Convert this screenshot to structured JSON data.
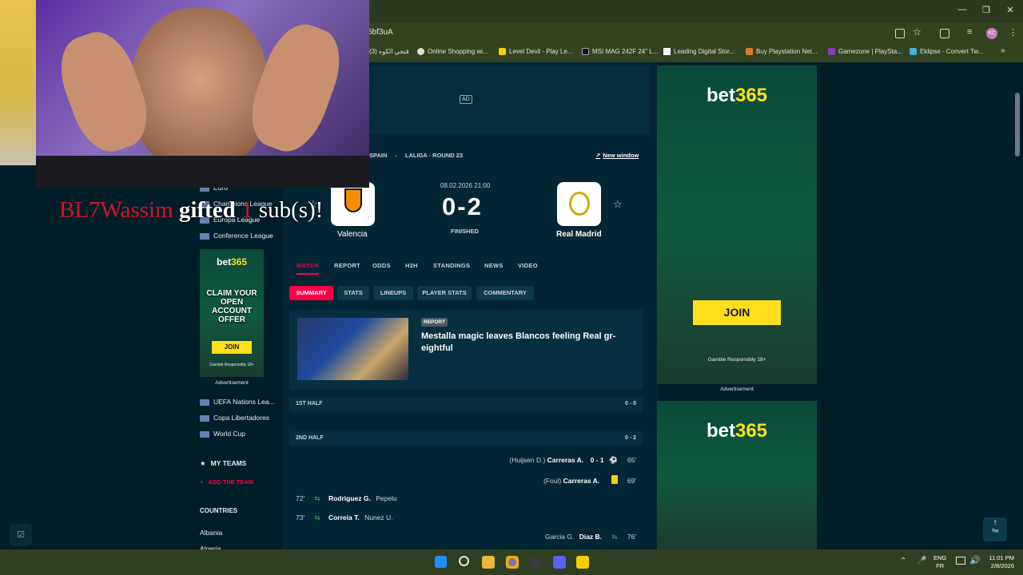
{
  "browser": {
    "url_fragment": "5bf3uA",
    "bookmarks": [
      "قنحي الكوه (3)",
      "Online Shopping wi...",
      "Level Devil - Play Le...",
      "MSI MAG 242F 24\" L...",
      "Leading Digital Stor...",
      "Buy Playstation Net...",
      "Gamezone | PlaySta...",
      "Eklipse - Convert Tw..."
    ],
    "avatar_label": "KC"
  },
  "left_nav": {
    "top_items": [
      "Euro",
      "Champions League",
      "Europa League",
      "Conference League"
    ],
    "ad": {
      "brand": "bet",
      "brand_accent": "365",
      "headline": "CLAIM YOUR OPEN ACCOUNT OFFER",
      "join": "JOIN",
      "disclaimer": "Gamble Responsibly  18+",
      "label": "Advertisement"
    },
    "more_items": [
      "UEFA Nations Lea...",
      "Copa Libertadores",
      "World Cup"
    ],
    "my_teams_label": "MY TEAMS",
    "add_team_label": "ADD THE TEAM",
    "countries_label": "COUNTRIES",
    "countries": [
      "Albania",
      "Algeria"
    ]
  },
  "ad_top": {
    "label": "AD"
  },
  "match": {
    "breadcrumb_country": "SPAIN",
    "breadcrumb_league": "LALIGA - ROUND 23",
    "new_window": "New window",
    "datetime": "08.02.2026 21:00",
    "score": "0-2",
    "status": "FINISHED",
    "home": "Valencia",
    "away": "Real Madrid",
    "tabs": [
      "MATCH",
      "REPORT",
      "ODDS",
      "H2H",
      "STANDINGS",
      "NEWS",
      "VIDEO"
    ],
    "subtabs": [
      "SUMMARY",
      "STATS",
      "LINEUPS",
      "PLAYER STATS",
      "COMMENTARY"
    ],
    "report_badge": "REPORT",
    "report_title": "Mestalla magic leaves Blancos feeling Real gr-eightful",
    "first_half": {
      "label": "1ST HALF",
      "score": "0 - 0"
    },
    "second_half": {
      "label": "2ND HALF",
      "score": "0 - 2"
    },
    "events": [
      {
        "assist": "(Huijsen D.)",
        "player": "Carreras A.",
        "score": "0 - 1",
        "minute": "65'"
      },
      {
        "assist": "(Foul)",
        "player": "Carreras A.",
        "minute": "69'"
      },
      {
        "minute": "72'",
        "player": "Rodriguez G.",
        "sub": "Pepelu"
      },
      {
        "minute": "73'",
        "player": "Correia T.",
        "sub": "Nunez U."
      },
      {
        "sub": "Garcia G.",
        "player": "Diaz B.",
        "minute": "76'"
      }
    ]
  },
  "right_ad": {
    "brand": "bet",
    "brand_accent": "365",
    "join": "JOIN",
    "disclaimer": "Gamble Responsibly  18+",
    "label": "Advertisement"
  },
  "top_button": "Top",
  "stream_overlay": {
    "user": "BL7Wassim",
    "gifted": "gifted",
    "count": "1",
    "subs": "sub(s)!"
  },
  "taskbar": {
    "lang1": "ENG",
    "lang2": "FR",
    "time": "11:01 PM",
    "date": "2/8/2026"
  },
  "colors": {
    "accent": "#ff0046",
    "ad_yellow": "#ffdf1b",
    "bg": "#001e28"
  }
}
